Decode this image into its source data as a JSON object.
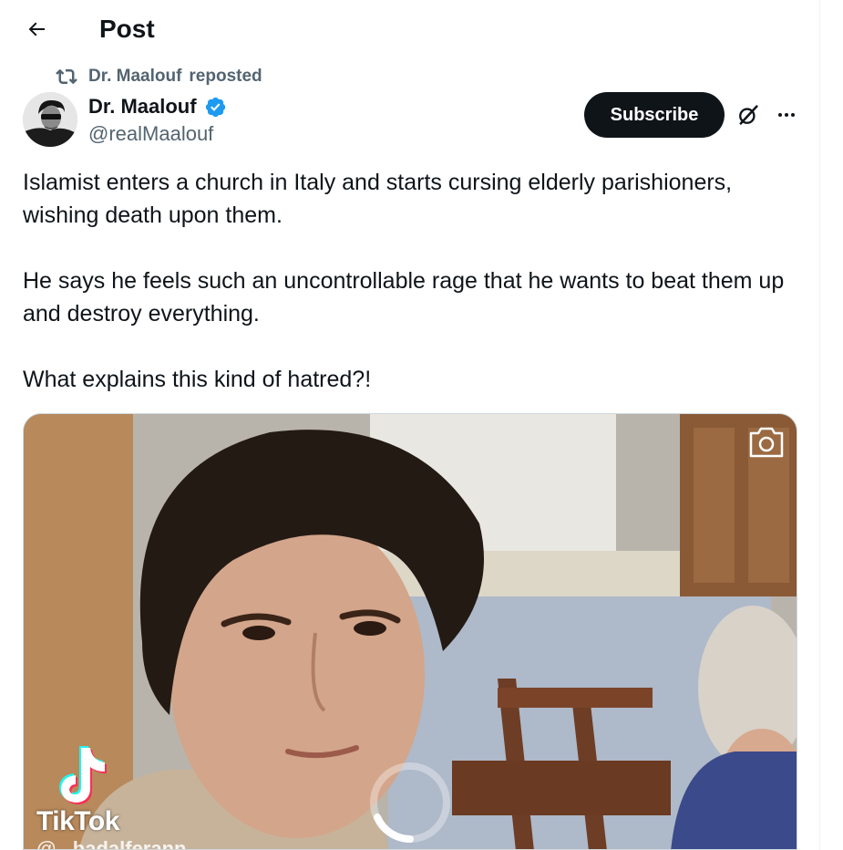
{
  "header": {
    "title": "Post"
  },
  "repost": {
    "name": "Dr. Maalouf",
    "label": "reposted"
  },
  "author": {
    "name": "Dr. Maalouf",
    "handle": "@realMaalouf",
    "verified": true,
    "avatar_icon": "avatar-photo"
  },
  "actions": {
    "subscribe_label": "Subscribe",
    "grok_icon": "grok-icon",
    "more_icon": "more-icon"
  },
  "post": {
    "paragraphs": [
      "Islamist enters a church in Italy and starts cursing elderly parishioners, wishing death upon them.",
      "He says he feels such an uncontrollable rage that he wants to beat them up and destroy everything.",
      "What explains this kind of hatred?!"
    ]
  },
  "media": {
    "type": "video",
    "watermark": "TikTok",
    "watermark_handle": "@...badalferann",
    "camera_icon": "camera-icon",
    "loading": true
  },
  "colors": {
    "text_primary": "#0f1419",
    "text_secondary": "#536471",
    "verified_blue": "#1d9bf0",
    "button_dark": "#0f1419"
  }
}
